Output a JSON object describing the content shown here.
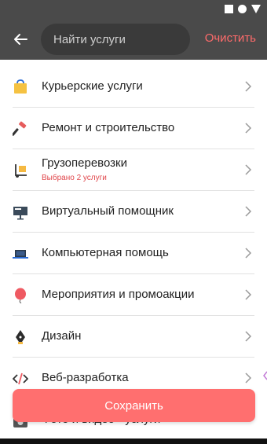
{
  "header": {
    "search_placeholder": "Найти услуги",
    "clear_label": "Очистить"
  },
  "categories": [
    {
      "label": "Курьерские услуги",
      "subtitle": "",
      "icon": "courier-bag-icon"
    },
    {
      "label": "Ремонт и строительство",
      "subtitle": "",
      "icon": "hammer-icon"
    },
    {
      "label": "Грузоперевозки",
      "subtitle": "Выбрано 2 услуги",
      "icon": "hand-truck-icon"
    },
    {
      "label": "Виртуальный помощник",
      "subtitle": "",
      "icon": "monitor-icon"
    },
    {
      "label": "Компьютерная помощь",
      "subtitle": "",
      "icon": "laptop-icon"
    },
    {
      "label": "Мероприятия и промоакции",
      "subtitle": "",
      "icon": "balloon-icon"
    },
    {
      "label": "Дизайн",
      "subtitle": "",
      "icon": "pen-nib-icon"
    },
    {
      "label": "Веб-разработка",
      "subtitle": "",
      "icon": "code-icon"
    },
    {
      "label": "Фото и видео - услуги",
      "subtitle": "",
      "icon": "camera-icon"
    }
  ],
  "save_label": "Сохранить",
  "colors": {
    "header_bg": "#4a4a4a",
    "accent": "#ff6f6f",
    "subtitle_red": "#e0474c"
  }
}
